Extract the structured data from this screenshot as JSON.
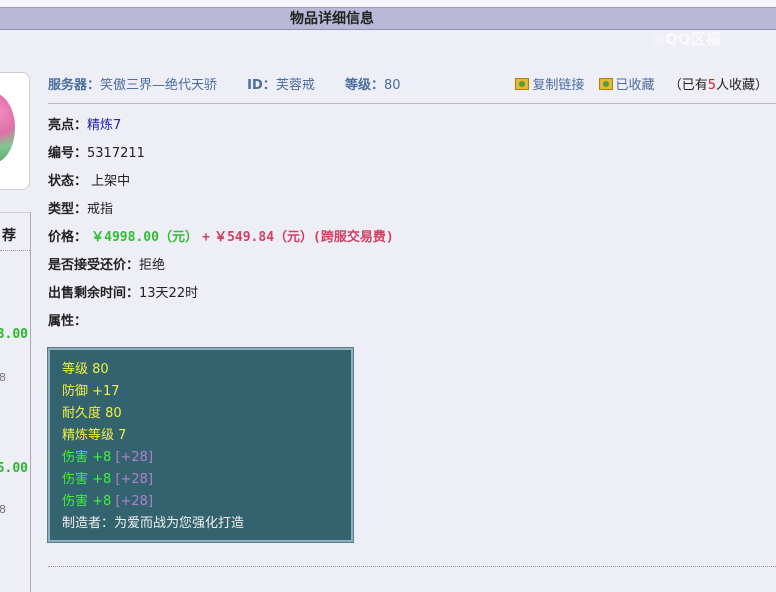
{
  "header": {
    "title": "物品详细信息"
  },
  "watermark": "◎QQ区福",
  "left_panel": {
    "title": "荐",
    "items": [
      {
        "price": "3.00",
        "sub": "8"
      },
      {
        "price": "5.00",
        "sub": "8"
      }
    ]
  },
  "info": {
    "server_label": "服务器：",
    "server": "笑傲三界—绝代天骄",
    "id_label": "ID：",
    "id": "芙蓉戒",
    "level_label": "等级：",
    "level": "80",
    "copy_link": "复制链接",
    "favorited": "已收藏",
    "fav_prefix": "（已有",
    "fav_count": "5",
    "fav_suffix": "人收藏）"
  },
  "details": [
    {
      "label": "亮点：",
      "value": "精炼7"
    },
    {
      "label": "编号：",
      "value": "5317211"
    },
    {
      "label": "状态：",
      "value": " 上架中"
    },
    {
      "label": "类型：",
      "value": "戒指"
    },
    {
      "label": "价格：",
      "price": "￥4998.00（元）",
      "plus": "+",
      "fee": "￥549.84（元）(跨服交易费)"
    },
    {
      "label": "是否接受还价：",
      "value": "拒绝"
    },
    {
      "label": "出售剩余时间：",
      "value": "13天22时"
    },
    {
      "label": "属性：",
      "value": ""
    }
  ],
  "stats": [
    {
      "text": "等级 80",
      "extra": ""
    },
    {
      "text": "防御 +17",
      "extra": ""
    },
    {
      "text": "耐久度 80",
      "extra": ""
    },
    {
      "text": "精炼等级 7",
      "extra": ""
    },
    {
      "text": "伤害 +8",
      "extra": "[+28]"
    },
    {
      "text": "伤害 +8",
      "extra": "[+28]"
    },
    {
      "text": "伤害 +8",
      "extra": "[+28]"
    },
    {
      "text": "制造者：为爱而战为您强化打造",
      "extra": ""
    }
  ]
}
